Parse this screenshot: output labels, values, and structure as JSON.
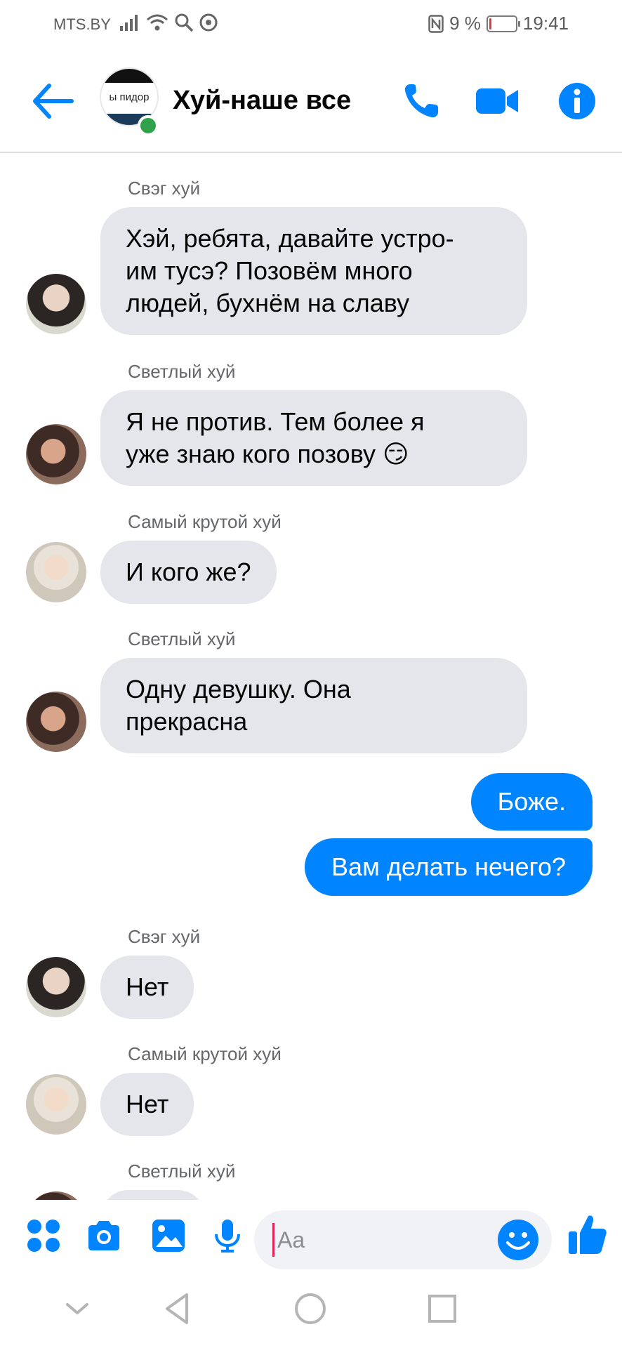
{
  "status_bar": {
    "carrier": "MTS.BY",
    "battery_percent": "9 %",
    "battery_level": 0.09,
    "time": "19:41"
  },
  "header": {
    "chat_title": "Хуй-наше все",
    "avatar_text": "ы пидор",
    "accent_color": "#0084ff",
    "online_color": "#31a24c"
  },
  "messages": [
    {
      "sender": "Свэг хуй",
      "lines": [
        "Хэй, ребята, давайте устро-",
        "им тусэ? Позовём много",
        "людей, бухнём на славу"
      ]
    },
    {
      "sender": "Светлый хуй",
      "lines": [
        "Я не против. Тем более я",
        "уже знаю кого позову 😏"
      ]
    },
    {
      "sender": "Самый крутой хуй",
      "lines": [
        "И кого же?"
      ]
    },
    {
      "sender": "Светлый хуй",
      "lines": [
        "Одну девушку. Она",
        "прекрасна"
      ]
    },
    {
      "sender": "",
      "lines": [
        "Боже."
      ]
    },
    {
      "sender": "",
      "lines": [
        "Вам делать нечего?"
      ]
    },
    {
      "sender": "Свэг хуй",
      "lines": [
        "Нет"
      ]
    },
    {
      "sender": "Самый крутой хуй",
      "lines": [
        "Нет"
      ]
    },
    {
      "sender": "Светлый хуй",
      "lines": []
    }
  ],
  "composer": {
    "placeholder": "Aa"
  },
  "icons": {
    "header": [
      "back-arrow-icon",
      "phone-icon",
      "video-camera-icon",
      "info-icon"
    ],
    "composer": [
      "apps-grid-icon",
      "camera-icon",
      "gallery-icon",
      "microphone-icon",
      "emoji-icon",
      "thumbs-up-icon"
    ],
    "navigation": [
      "collapse-chevron-icon",
      "back-triangle-icon",
      "home-circle-icon",
      "recents-square-icon"
    ]
  }
}
